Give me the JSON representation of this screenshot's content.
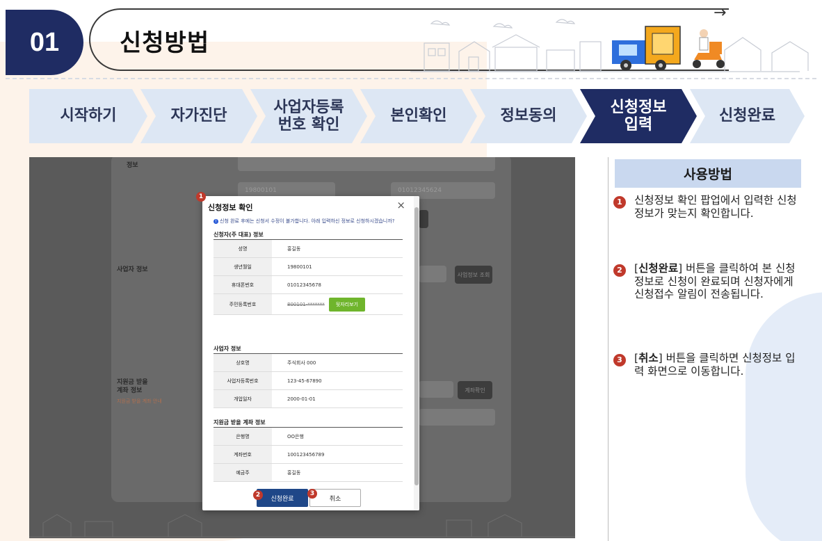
{
  "header": {
    "number": "01",
    "title": "신청방법"
  },
  "steps": [
    {
      "label": "시작하기",
      "line2": ""
    },
    {
      "label": "자가진단",
      "line2": ""
    },
    {
      "label": "사업자등록",
      "line2": "번호 확인"
    },
    {
      "label": "본인확인",
      "line2": ""
    },
    {
      "label": "정보동의",
      "line2": ""
    },
    {
      "label": "신청정보",
      "line2": "입력"
    },
    {
      "label": "신청완료",
      "line2": ""
    }
  ],
  "active_step": 5,
  "background_form": {
    "label_info": "정보",
    "label_business": "사업자 정보",
    "label_account": "지원금 받을",
    "label_account2": "계좌 정보",
    "label_account_note": "지원금 받을 계좌 안내",
    "field_birth": "19800101",
    "field_phone": "01012345624",
    "button_business": "사업정보 조회",
    "button_account": "계좌확인"
  },
  "modal": {
    "title": "신청정보 확인",
    "close": "×",
    "notice": "신청 완료 후에는 신청서 수정이 불가합니다. 아래 입력하신 정보로 신청하시겠습니까?",
    "sections": [
      {
        "title": "신청자(주 대표) 정보",
        "rows": [
          {
            "key": "성명",
            "value": "홍길동"
          },
          {
            "key": "생년월일",
            "value": "19800101"
          },
          {
            "key": "휴대폰번호",
            "value": "01012345678"
          },
          {
            "key": "주민등록번호",
            "value": "800101-*******",
            "button": "뒷자리보기"
          }
        ]
      },
      {
        "title": "사업자 정보",
        "rows": [
          {
            "key": "상호명",
            "value": "주식회사 000"
          },
          {
            "key": "사업자등록번호",
            "value": "123-45-67890"
          },
          {
            "key": "개업일자",
            "value": "2000-01-01"
          }
        ]
      },
      {
        "title": "지원금 받을 계좌 정보",
        "rows": [
          {
            "key": "은행명",
            "value": "OO은행"
          },
          {
            "key": "계좌번호",
            "value": "100123456789"
          },
          {
            "key": "예금주",
            "value": "홍길동"
          }
        ]
      }
    ],
    "confirm_button": "신청완료",
    "cancel_button": "취소"
  },
  "markers": [
    "1",
    "2",
    "3"
  ],
  "usage": {
    "title": "사용방법",
    "items": [
      {
        "num": "1",
        "pre": "",
        "bold": "",
        "post": "신청정보 확인 팝업에서 입력한 신청정보가 맞는지 확인합니다."
      },
      {
        "num": "2",
        "pre": "[",
        "bold": "신청완료",
        "post": "] 버튼을 클릭하여 본 신청정보로 신청이 완료되며 신청자에게 신청접수 알림이 전송됩니다."
      },
      {
        "num": "3",
        "pre": "[",
        "bold": "취소",
        "post": "] 버튼을 클릭하면 신청정보 입력 화면으로 이동합니다."
      }
    ]
  },
  "colors": {
    "navy": "#1f2c63",
    "step_bg": "#dde7f4",
    "marker_red": "#c0392b",
    "confirm_blue": "#1f4788",
    "green": "#6fb52c"
  }
}
